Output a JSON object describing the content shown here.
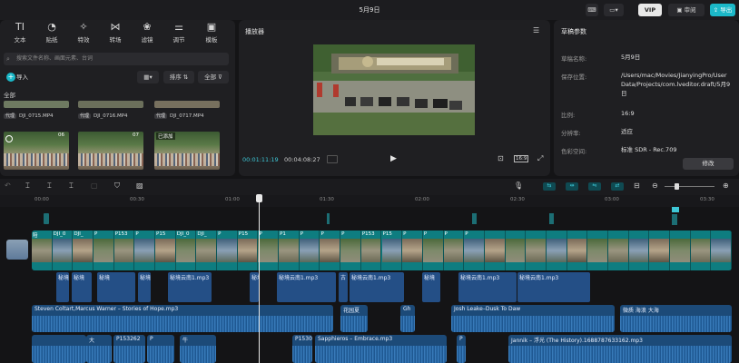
{
  "window": {
    "title": "5月9日"
  },
  "titlebar": {
    "review_label": "审阅",
    "export_label": "导出",
    "vip_label": "VIP"
  },
  "tools": [
    {
      "label": "文本",
      "icon": "text-icon",
      "glyph": "TI"
    },
    {
      "label": "贴纸",
      "icon": "sticker-icon",
      "glyph": "◔"
    },
    {
      "label": "特效",
      "icon": "effects-icon",
      "glyph": "✧"
    },
    {
      "label": "转场",
      "icon": "transition-icon",
      "glyph": "⋈"
    },
    {
      "label": "滤镜",
      "icon": "filter-icon",
      "glyph": "❀"
    },
    {
      "label": "调节",
      "icon": "adjust-icon",
      "glyph": "⚌"
    },
    {
      "label": "模板",
      "icon": "template-icon",
      "glyph": "▣"
    }
  ],
  "media": {
    "search_placeholder": "搜索文件名称、画面元素、台词",
    "import_label": "导入",
    "sort_label": "排序",
    "all_filter_label": "全部",
    "section_label": "全部",
    "files": [
      {
        "tag": "代理",
        "name": "DJI_0715.MP4"
      },
      {
        "tag": "代理",
        "name": "DJI_0716.MP4"
      },
      {
        "tag": "代理",
        "name": "DJI_0717.MP4"
      }
    ],
    "thumb_badges": [
      "06",
      "07",
      "已添加"
    ]
  },
  "player": {
    "title": "播放器",
    "current_time": "00:01:11:19",
    "duration": "00:04:08:27",
    "ratio_label": "16:9"
  },
  "props": {
    "title": "草稿参数",
    "rows": [
      {
        "label": "草稿名称:",
        "value": "5月9日"
      },
      {
        "label": "保存位置:",
        "value": "/Users/mac/Movies/JianyingPro/User Data/Projects/com.lveditor.draft/5月9日"
      },
      {
        "label": "比例:",
        "value": "16:9"
      },
      {
        "label": "分辨率:",
        "value": "适应"
      },
      {
        "label": "色彩空间:",
        "value": "标准 SDR - Rec.709"
      }
    ],
    "modify_label": "修改"
  },
  "timeline": {
    "ticks": [
      "00:00",
      "00:30",
      "01:00",
      "01:30",
      "02:00",
      "02:30",
      "03:00",
      "03:30"
    ],
    "video_labels": [
      "陪",
      "DJI_0",
      "DJI_",
      "P",
      "P153",
      "P",
      "P15",
      "DJI_0",
      "DJI_",
      "P",
      "P15",
      "P",
      "P1",
      "P",
      "P",
      "P",
      "P153",
      "P15",
      "P",
      "P",
      "P",
      "P"
    ],
    "sfx_labels": [
      "秘境",
      "秘境",
      "秘境",
      "秘境",
      "秘境云南1.mp3",
      "秘境",
      "秘境云南1.mp3",
      "古",
      "秘境云南1.mp3",
      "秘境",
      "秘境云南1.mp3",
      "秘境云南1.mp3"
    ],
    "music_track": [
      {
        "label": "Steven Coltart,Marcus Warner – Stories of Hope.mp3"
      },
      {
        "label": "花园夏"
      },
      {
        "label": "Gh"
      },
      {
        "label": "Josh Leake–Dusk To Daw"
      },
      {
        "label": "微质 海浪 大海"
      }
    ],
    "bottom_track": [
      {
        "label": "大"
      },
      {
        "label": "P153262"
      },
      {
        "label": "P"
      },
      {
        "label": "牛"
      },
      {
        "label": "P1530"
      },
      {
        "label": "Sapphieros – Embrace.mp3"
      },
      {
        "label": "P"
      },
      {
        "label": "Jannik – 浮光 (The History).1688787633162.mp3"
      }
    ]
  }
}
